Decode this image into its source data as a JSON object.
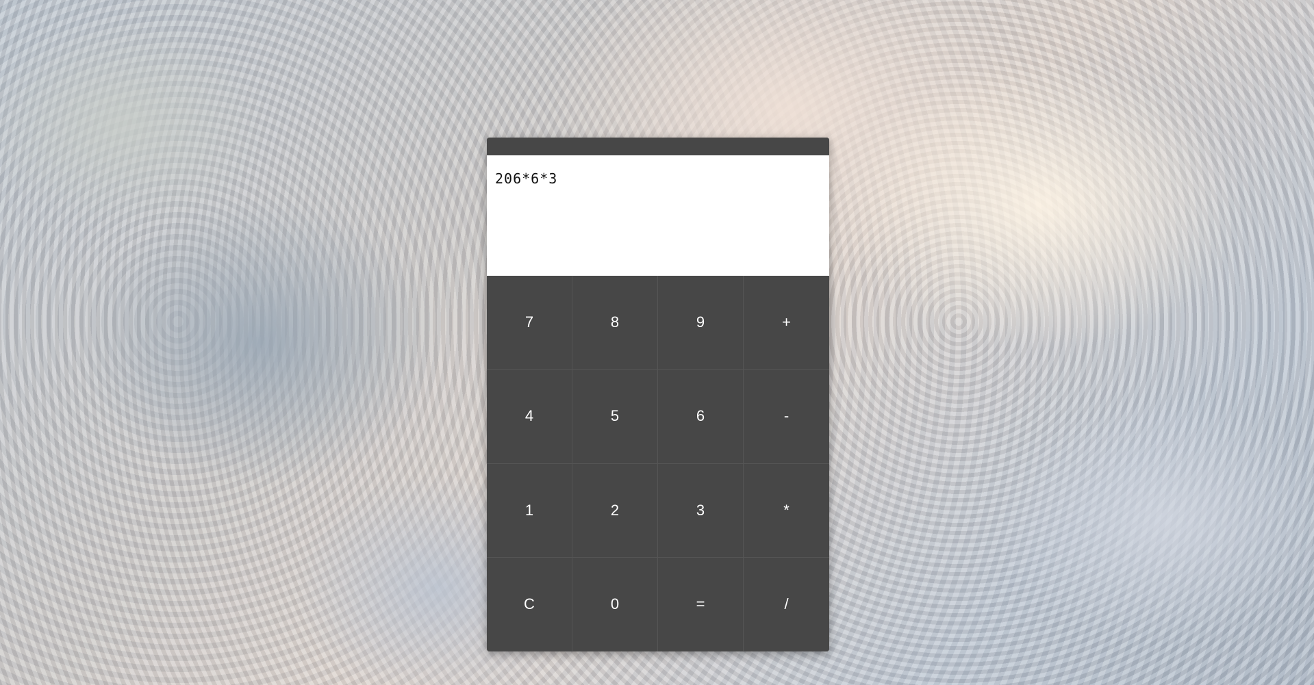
{
  "display": {
    "expression": "206*6*3"
  },
  "keypad": {
    "keys": [
      "7",
      "8",
      "9",
      "+",
      "4",
      "5",
      "6",
      "-",
      "1",
      "2",
      "3",
      "*",
      "C",
      "0",
      "=",
      "/"
    ]
  },
  "colors": {
    "window_bg": "#474747",
    "display_bg": "#ffffff",
    "key_text": "#ffffff",
    "display_text": "#111111"
  }
}
